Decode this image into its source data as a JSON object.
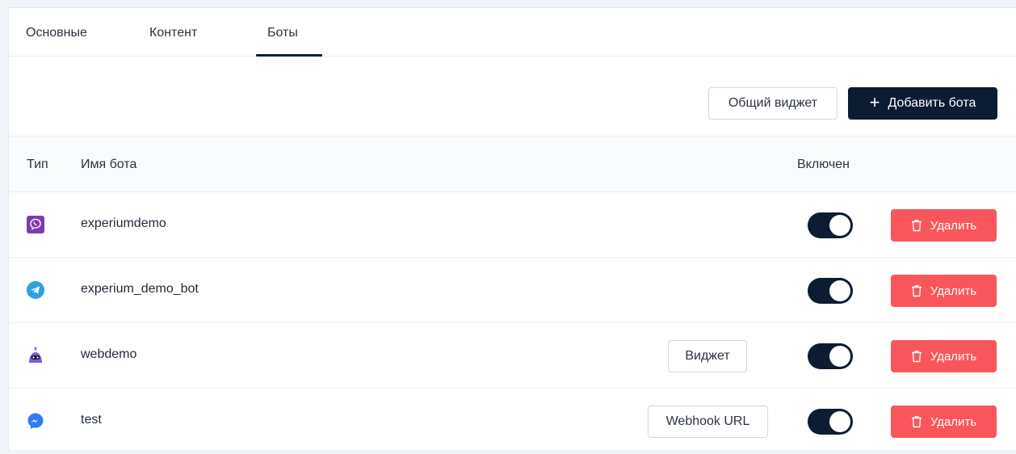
{
  "tabs": [
    {
      "label": "Основные"
    },
    {
      "label": "Контент"
    },
    {
      "label": "Боты",
      "active": true
    }
  ],
  "toolbar": {
    "common_widget_label": "Общий виджет",
    "add_bot_label": "Добавить бота",
    "add_icon": "+"
  },
  "table": {
    "headers": {
      "type": "Тип",
      "name": "Имя бота",
      "enabled": "Включен"
    },
    "rows": [
      {
        "type_icon": "viber-icon",
        "name": "experiumdemo",
        "extra_label": "",
        "enabled": true,
        "delete_label": "Удалить"
      },
      {
        "type_icon": "telegram-icon",
        "name": "experium_demo_bot",
        "extra_label": "",
        "enabled": true,
        "delete_label": "Удалить"
      },
      {
        "type_icon": "robot-icon",
        "name": "webdemo",
        "extra_label": "Виджет",
        "enabled": true,
        "delete_label": "Удалить"
      },
      {
        "type_icon": "messenger-icon",
        "name": "test",
        "extra_label": "Webhook URL",
        "enabled": true,
        "delete_label": "Удалить"
      }
    ]
  },
  "colors": {
    "primary": "#0d1b33",
    "danger": "#f9565b",
    "viber": "#7d3daf",
    "telegram": "#2aa3df",
    "robot": "#7b5cd6",
    "messenger": "#2f7cf6"
  }
}
